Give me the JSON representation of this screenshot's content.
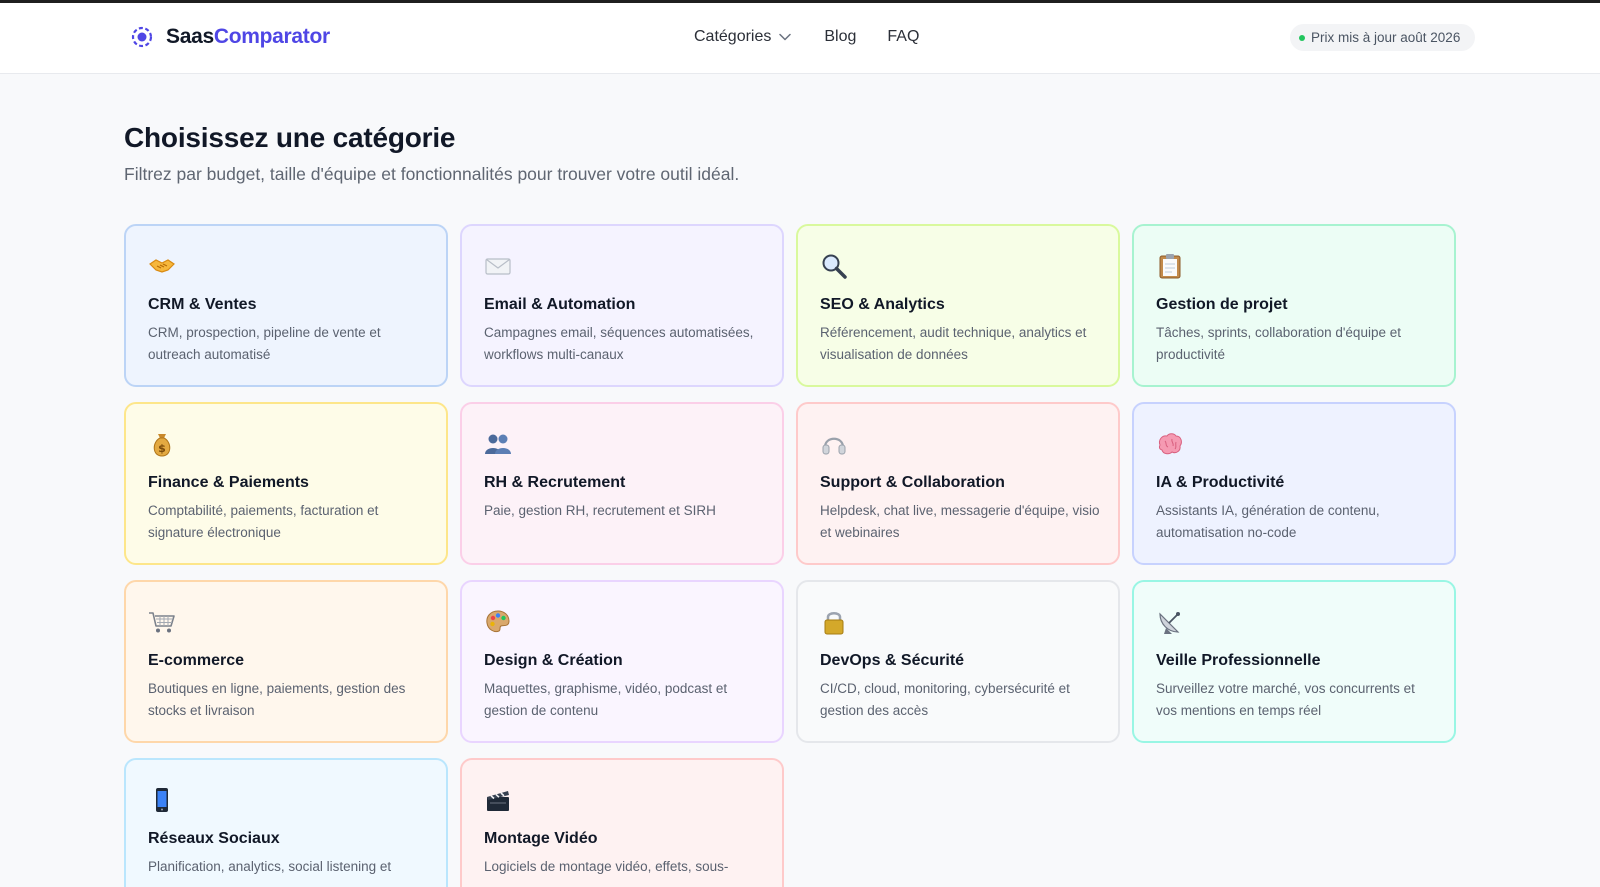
{
  "header": {
    "brand_part1": "Saas",
    "brand_part2": "Comparator",
    "brand_color": "#4f46e5",
    "nav": [
      {
        "label": "Catégories",
        "icon": "chevron-down-icon"
      },
      {
        "label": "Blog"
      },
      {
        "label": "FAQ"
      }
    ],
    "price_badge": "Prix mis à jour août 2026",
    "status_color": "#22c55e"
  },
  "main": {
    "title": "Choisissez une catégorie",
    "subtitle": "Filtrez par budget, taille d'équipe et fonctionnalités pour trouver votre outil idéal."
  },
  "categories": [
    {
      "title": "CRM & Ventes",
      "desc": "CRM, prospection, pipeline de vente et outreach automatisé",
      "icon": "handshake-icon",
      "bg": "#eef4fe",
      "border": "#bcd4f6"
    },
    {
      "title": "Email & Automation",
      "desc": "Campagnes email, séquences automatisées, workflows multi-canaux",
      "icon": "envelope-icon",
      "bg": "#f5f3ff",
      "border": "#ddd6fe"
    },
    {
      "title": "SEO & Analytics",
      "desc": "Référencement, audit technique, analytics et visualisation de données",
      "icon": "magnifier-icon",
      "bg": "#f7fee7",
      "border": "#d9f99d"
    },
    {
      "title": "Gestion de projet",
      "desc": "Tâches, sprints, collaboration d'équipe et productivité",
      "icon": "clipboard-icon",
      "bg": "#ecfdf5",
      "border": "#a7f3d0"
    },
    {
      "title": "Finance & Paiements",
      "desc": "Comptabilité, paiements, facturation et signature électronique",
      "icon": "money-bag-icon",
      "bg": "#fefce8",
      "border": "#fde68a"
    },
    {
      "title": "RH & Recrutement",
      "desc": "Paie, gestion RH, recrutement et SIRH",
      "icon": "people-icon",
      "bg": "#fdf2f8",
      "border": "#fbcfe8"
    },
    {
      "title": "Support & Collaboration",
      "desc": "Helpdesk, chat live, messagerie d'équipe, visio et webinaires",
      "icon": "headphones-icon",
      "bg": "#fef2f2",
      "border": "#fecaca"
    },
    {
      "title": "IA & Productivité",
      "desc": "Assistants IA, génération de contenu, automatisation no-code",
      "icon": "brain-icon",
      "bg": "#eef2ff",
      "border": "#c7d2fe"
    },
    {
      "title": "E-commerce",
      "desc": "Boutiques en ligne, paiements, gestion des stocks et livraison",
      "icon": "shopping-cart-icon",
      "bg": "#fff7ed",
      "border": "#fed7aa"
    },
    {
      "title": "Design & Création",
      "desc": "Maquettes, graphisme, vidéo, podcast et gestion de contenu",
      "icon": "palette-icon",
      "bg": "#faf5ff",
      "border": "#e9d5ff"
    },
    {
      "title": "DevOps & Sécurité",
      "desc": "CI/CD, cloud, monitoring, cybersécurité et gestion des accès",
      "icon": "padlock-icon",
      "bg": "#f9fafb",
      "border": "#e5e7eb"
    },
    {
      "title": "Veille Professionnelle",
      "desc": "Surveillez votre marché, vos concurrents et vos mentions en temps réel",
      "icon": "satellite-dish-icon",
      "bg": "#f0fdfa",
      "border": "#99f6e4"
    },
    {
      "title": "Réseaux Sociaux",
      "desc": "Planification, analytics, social listening et",
      "icon": "mobile-phone-icon",
      "bg": "#f0f9ff",
      "border": "#bae6fd"
    },
    {
      "title": "Montage Vidéo",
      "desc": "Logiciels de montage vidéo, effets, sous-",
      "icon": "clapperboard-icon",
      "bg": "#fef2f2",
      "border": "#fecaca"
    }
  ]
}
